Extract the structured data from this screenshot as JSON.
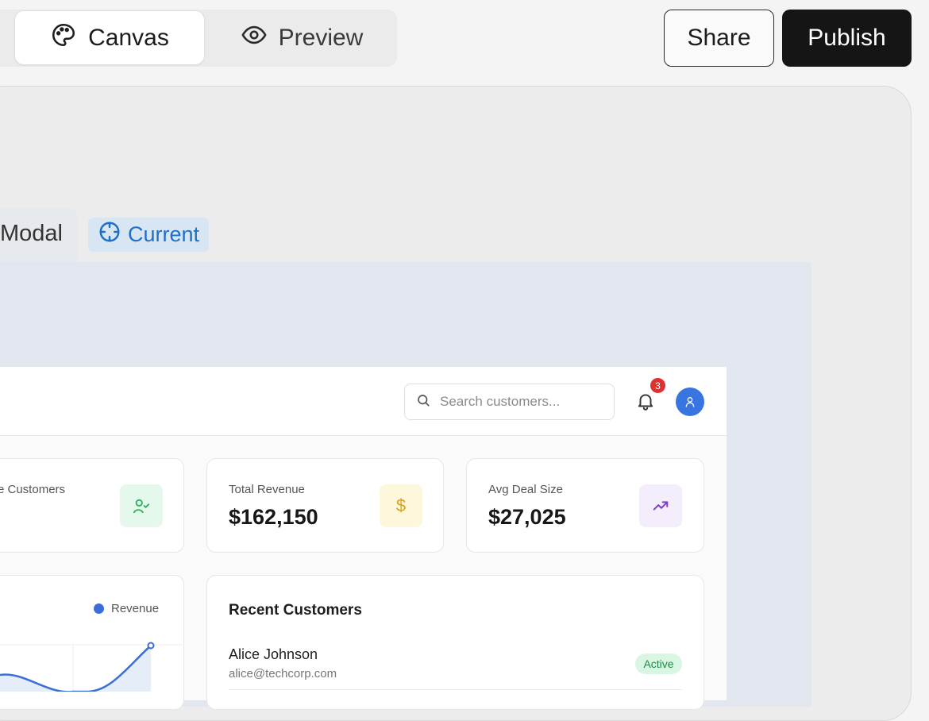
{
  "toolbar": {
    "tabs": [
      {
        "label": "Canvas",
        "icon": "palette-icon",
        "active": true
      },
      {
        "label": "Preview",
        "icon": "eye-icon",
        "active": false
      }
    ],
    "share_label": "Share",
    "publish_label": "Publish"
  },
  "canvas": {
    "frame_tabs": [
      {
        "label": "Modal"
      },
      {
        "label": "Current",
        "icon": "crosshair-icon"
      }
    ]
  },
  "app": {
    "search": {
      "placeholder": "Search customers..."
    },
    "notifications": {
      "count": "3"
    },
    "stats": [
      {
        "title": "e Customers",
        "value": "",
        "icon": "user-check-icon",
        "icon_color": "#2fae5b",
        "icon_bg": "#e5f8ec"
      },
      {
        "title": "Total Revenue",
        "value": "$162,150",
        "icon": "dollar-icon",
        "icon_color": "#d9a21c",
        "icon_bg": "#fdf7dc"
      },
      {
        "title": "Avg Deal Size",
        "value": "$27,025",
        "icon": "trending-up-icon",
        "icon_color": "#7b3fcc",
        "icon_bg": "#f4eefc"
      }
    ],
    "chart": {
      "legend": "Revenue",
      "series_color": "#3a6fd8"
    },
    "recent": {
      "title": "Recent Customers",
      "customers": [
        {
          "name": "Alice Johnson",
          "email": "alice@techcorp.com",
          "status": "Active"
        }
      ]
    }
  },
  "colors": {
    "accent_blue": "#1f6fc6",
    "publish_bg": "#151515"
  }
}
